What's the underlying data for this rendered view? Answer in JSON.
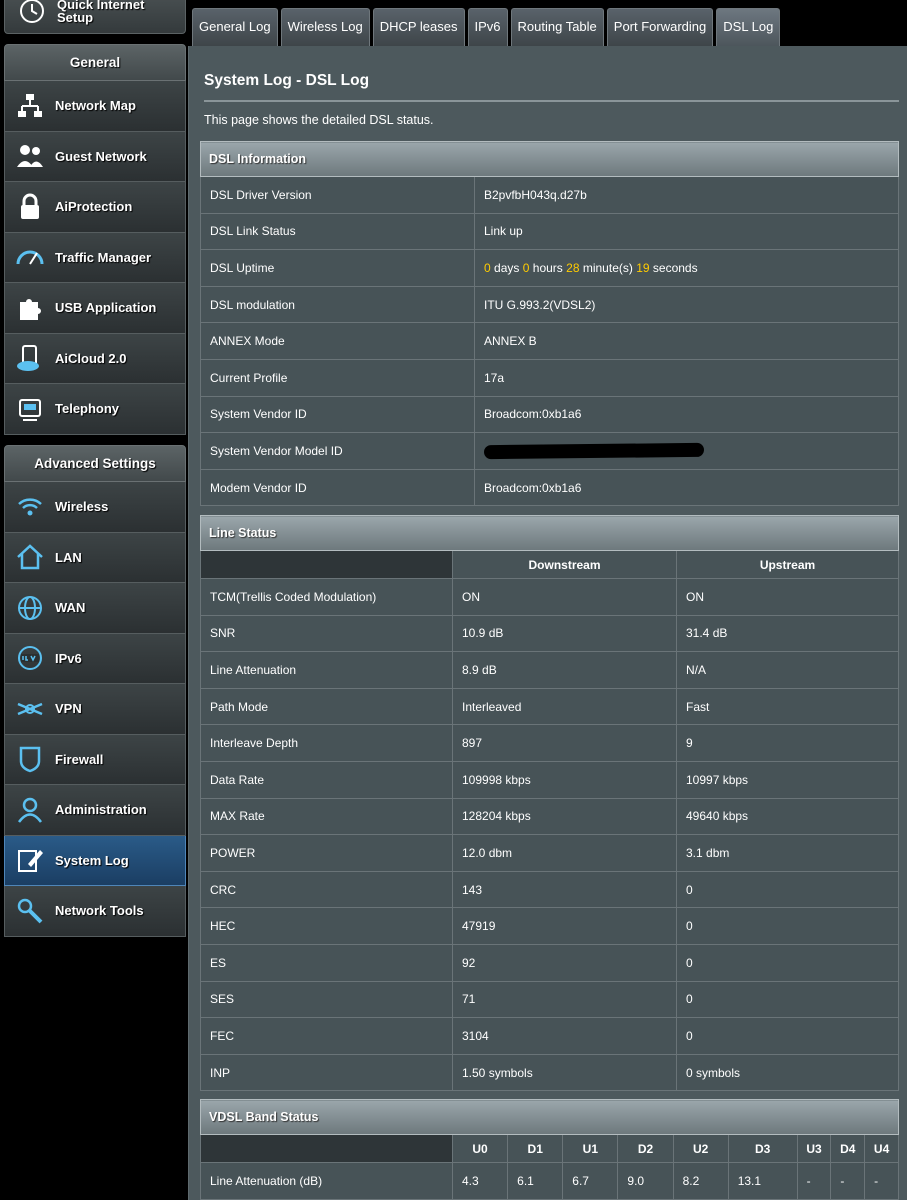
{
  "sidebar": {
    "qis_label_line1": "Quick Internet",
    "qis_label_line2": "Setup",
    "general_title": "General",
    "general_items": [
      {
        "label": "Network Map"
      },
      {
        "label": "Guest Network"
      },
      {
        "label": "AiProtection"
      },
      {
        "label": "Traffic Manager"
      },
      {
        "label": "USB Application"
      },
      {
        "label": "AiCloud 2.0"
      },
      {
        "label": "Telephony"
      }
    ],
    "advanced_title": "Advanced Settings",
    "advanced_items": [
      {
        "label": "Wireless"
      },
      {
        "label": "LAN"
      },
      {
        "label": "WAN"
      },
      {
        "label": "IPv6"
      },
      {
        "label": "VPN"
      },
      {
        "label": "Firewall"
      },
      {
        "label": "Administration"
      },
      {
        "label": "System Log"
      },
      {
        "label": "Network Tools"
      }
    ],
    "active_item": "System Log"
  },
  "tabs": [
    {
      "label": "General Log"
    },
    {
      "label": "Wireless Log"
    },
    {
      "label": "DHCP leases"
    },
    {
      "label": "IPv6"
    },
    {
      "label": "Routing Table"
    },
    {
      "label": "Port Forwarding"
    },
    {
      "label": "DSL Log"
    }
  ],
  "active_tab": "DSL Log",
  "page": {
    "title": "System Log - DSL Log",
    "description": "This page shows the detailed DSL status."
  },
  "dsl_info": {
    "section_title": "DSL Information",
    "rows": [
      {
        "key": "DSL Driver Version",
        "value": "B2pvfbH043q.d27b"
      },
      {
        "key": "DSL Link Status",
        "value": "Link up"
      },
      {
        "key": "DSL Uptime",
        "value": ""
      },
      {
        "key": "DSL modulation",
        "value": "ITU G.993.2(VDSL2)"
      },
      {
        "key": "ANNEX Mode",
        "value": "ANNEX B"
      },
      {
        "key": "Current Profile",
        "value": "17a"
      },
      {
        "key": "System Vendor ID",
        "value": "Broadcom:0xb1a6"
      },
      {
        "key": "System Vendor Model ID",
        "value": ""
      },
      {
        "key": "Modem Vendor ID",
        "value": "Broadcom:0xb1a6"
      }
    ],
    "uptime": {
      "days": "0",
      "days_label": "days",
      "hours": "0",
      "hours_label": "hours",
      "minutes": "28",
      "minutes_label": "minute(s)",
      "seconds": "19",
      "seconds_label": "seconds"
    }
  },
  "line_status": {
    "section_title": "Line Status",
    "col_downstream": "Downstream",
    "col_upstream": "Upstream",
    "rows": [
      {
        "key": "TCM(Trellis Coded Modulation)",
        "down": "ON",
        "up": "ON"
      },
      {
        "key": "SNR",
        "down": "10.9 dB",
        "up": "31.4 dB"
      },
      {
        "key": "Line Attenuation",
        "down": "8.9 dB",
        "up": "N/A"
      },
      {
        "key": "Path Mode",
        "down": "Interleaved",
        "up": "Fast"
      },
      {
        "key": "Interleave Depth",
        "down": "897",
        "up": "9"
      },
      {
        "key": "Data Rate",
        "down": "109998 kbps",
        "up": "10997 kbps"
      },
      {
        "key": "MAX Rate",
        "down": "128204 kbps",
        "up": "49640 kbps"
      },
      {
        "key": "POWER",
        "down": "12.0 dbm",
        "up": "3.1 dbm"
      },
      {
        "key": "CRC",
        "down": "143",
        "up": "0"
      },
      {
        "key": "HEC",
        "down": "47919",
        "up": "0"
      },
      {
        "key": "ES",
        "down": "92",
        "up": "0"
      },
      {
        "key": "SES",
        "down": "71",
        "up": "0"
      },
      {
        "key": "FEC",
        "down": "3104",
        "up": "0"
      },
      {
        "key": "INP",
        "down": "1.50 symbols",
        "up": "0 symbols"
      }
    ]
  },
  "vdsl_band": {
    "section_title": "VDSL Band Status",
    "bands": [
      "U0",
      "D1",
      "U1",
      "D2",
      "U2",
      "D3",
      "U3",
      "D4",
      "U4"
    ],
    "row_label": "Line Attenuation (dB)",
    "values": [
      "4.3",
      "6.1",
      "6.7",
      "9.0",
      "8.2",
      "13.1",
      "-",
      "-",
      "-"
    ],
    "colors": {
      "upstream": "#3ab0e8",
      "downstream": "#f08a2a"
    }
  }
}
